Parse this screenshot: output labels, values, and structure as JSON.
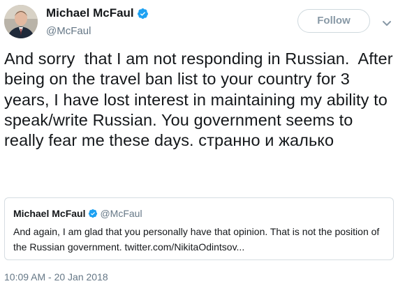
{
  "author": {
    "display_name": "Michael McFaul",
    "handle": "@McFaul",
    "avatar_icon": "profile-photo",
    "verified_icon": "verified-badge-icon"
  },
  "actions": {
    "follow_label": "Follow",
    "menu_icon": "chevron-down-icon"
  },
  "tweet": {
    "text": "And sorry  that I am not responding in Russian.  After being on the travel ban list to your country for 3 years, I have lost interest in maintaining my ability to speak/write Russian. You government seems to really fear me these days. странно и жалько"
  },
  "quoted_tweet": {
    "display_name": "Michael McFaul",
    "handle": "@McFaul",
    "text": "And again, I am glad that you personally have that opinion.  That is not the position of the Russian government. twitter.com/NikitaOdintsov..."
  },
  "timestamp": "10:09 AM - 20 Jan 2018",
  "colors": {
    "verified_blue": "#1da1f2",
    "secondary_text": "#657786",
    "primary_text": "#14171a",
    "border": "#d6dde2"
  }
}
